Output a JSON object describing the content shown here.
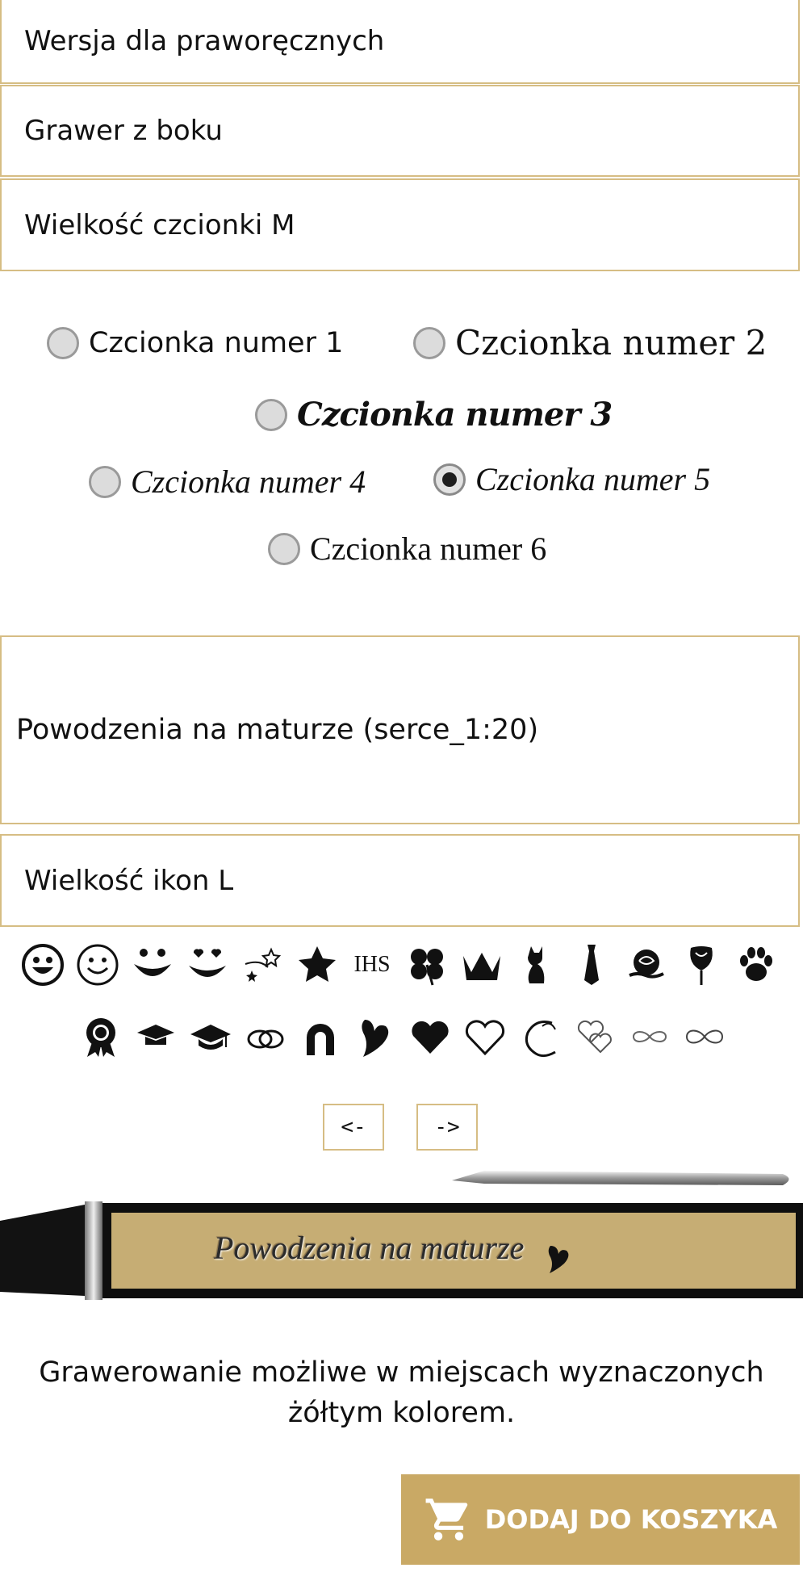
{
  "options": {
    "hand_version": "Wersja dla praworęcznych",
    "engraving_side": "Grawer z boku",
    "font_size": "Wielkość czcionki M"
  },
  "fonts": [
    {
      "label": "Czcionka numer 1",
      "checked": false
    },
    {
      "label": "Czcionka numer 2",
      "checked": false
    },
    {
      "label": "Czcionka numer 3",
      "checked": false
    },
    {
      "label": "Czcionka numer 4",
      "checked": false
    },
    {
      "label": "Czcionka numer 5",
      "checked": true
    },
    {
      "label": "Czcionka numer 6",
      "checked": false
    }
  ],
  "engraving_text": "Powodzenia na maturze (serce_1:20)",
  "icon_size": "Wielkość ikon L",
  "icons_row1": [
    "smiley-icon",
    "smiley-outline-icon",
    "grin-icon",
    "grin-hearts-icon",
    "stars-icon",
    "star-icon",
    "ihs-icon",
    "clover-icon",
    "crown-icon",
    "cat-icon",
    "tie-icon",
    "rose-icon",
    "rose-bud-icon",
    "paw-icon"
  ],
  "icons_row2": [
    "award-icon",
    "graduation-cap-icon",
    "graduation-cap-2-icon",
    "rings-icon",
    "horseshoe-icon",
    "heart-brush-icon",
    "heart-icon",
    "heart-outline-icon",
    "heart-swirl-icon",
    "hearts-outline-icon",
    "infinity-thin-icon",
    "infinity-icon"
  ],
  "ihs_text": "IHS",
  "pager": {
    "prev": "<-",
    "next": "->"
  },
  "preview_text": "Powodzenia na maturze",
  "info_line1": "Grawerowanie możliwe w miejscach wyznaczonych",
  "info_line2": "żółtym kolorem.",
  "cart_label": "DODAJ DO KOSZYKA",
  "colors": {
    "accent": "#c9a965",
    "border": "#d6bd84"
  }
}
